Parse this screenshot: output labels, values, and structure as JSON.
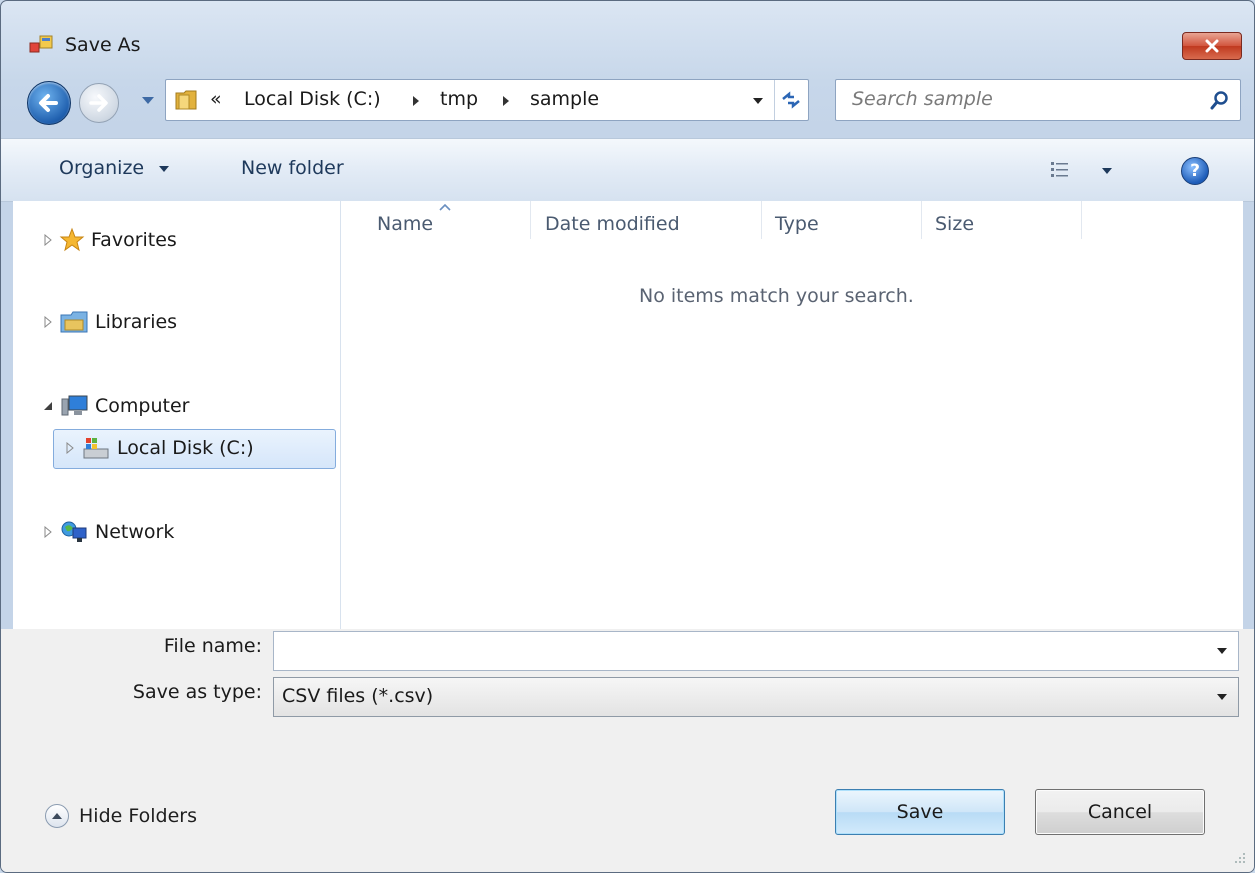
{
  "window": {
    "title": "Save As",
    "close_icon": "close-x-icon"
  },
  "navigation": {
    "back_icon": "back-arrow-icon",
    "forward_icon": "forward-arrow-icon",
    "overflow_symbol": "«",
    "breadcrumb": [
      "Local Disk (C:)",
      "tmp",
      "sample"
    ],
    "search_placeholder": "Search sample"
  },
  "toolbar": {
    "organize_label": "Organize",
    "new_folder_label": "New folder",
    "help_label": "?"
  },
  "tree": {
    "favorites": "Favorites",
    "libraries": "Libraries",
    "computer": "Computer",
    "local_disk": "Local Disk (C:)",
    "network": "Network"
  },
  "file_list": {
    "columns": [
      "Name",
      "Date modified",
      "Type",
      "Size"
    ],
    "empty_message": "No items match your search."
  },
  "form": {
    "file_name_label": "File name:",
    "file_name_value": "",
    "save_as_type_label": "Save as type:",
    "save_as_type_value": "CSV files (*.csv)"
  },
  "buttons": {
    "hide_folders": "Hide Folders",
    "save": "Save",
    "cancel": "Cancel"
  },
  "colors": {
    "accent": "#1f5fae",
    "close": "#c0391f",
    "selection": "#d5e6fa"
  }
}
